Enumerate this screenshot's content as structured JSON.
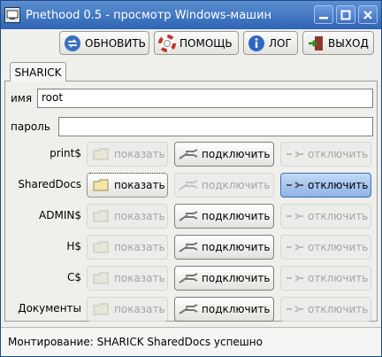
{
  "window": {
    "title": "Pnethood 0.5 - просмотр Windows-машин"
  },
  "toolbar": {
    "refresh": "ОБНОВИТЬ",
    "help": "ПОМОЩЬ",
    "log": "ЛОГ",
    "exit": "ВЫХОД"
  },
  "tab": {
    "label": "SHARICK"
  },
  "login": {
    "name_label": "имя",
    "name_value": "root",
    "password_label": "пароль",
    "password_value": ""
  },
  "labels": {
    "show": "показать",
    "connect": "подключить",
    "disconnect": "отключить"
  },
  "shares": [
    {
      "name": "print$"
    },
    {
      "name": "SharedDocs"
    },
    {
      "name": "ADMIN$"
    },
    {
      "name": "H$"
    },
    {
      "name": "C$"
    },
    {
      "name": "Документы"
    }
  ],
  "status": {
    "text": "Монтирование: SHARICK SharedDocs успешно"
  }
}
